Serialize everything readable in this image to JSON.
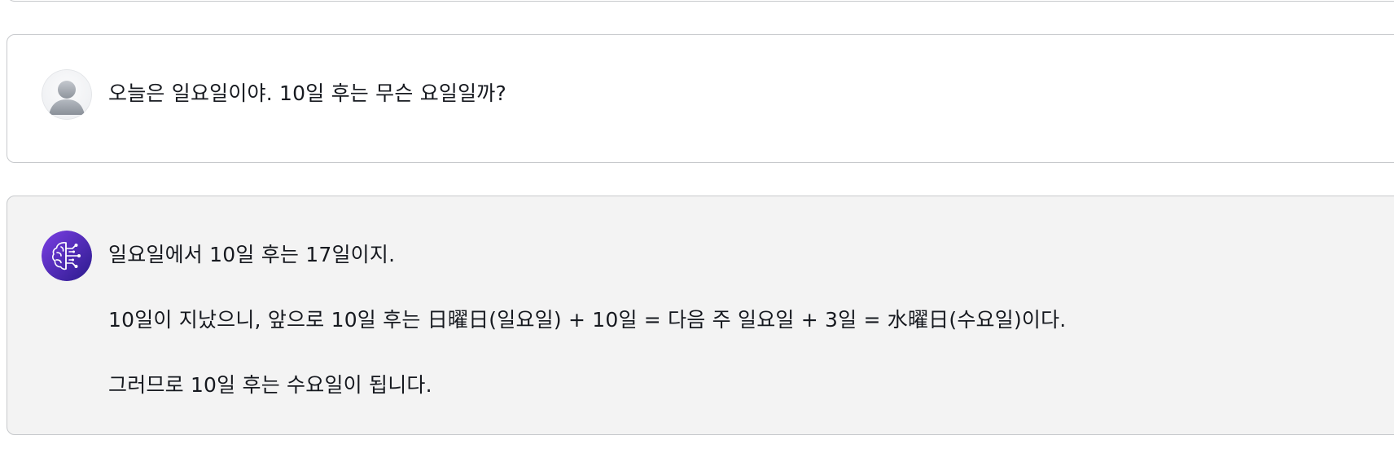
{
  "conversation": {
    "messages": [
      {
        "role": "user",
        "avatar_icon": "user-avatar-icon",
        "text": "오늘은 일요일이야. 10일 후는 무슨 요일일까?"
      },
      {
        "role": "assistant",
        "avatar_icon": "ai-brain-circuit-icon",
        "paragraphs": [
          "일요일에서 10일 후는 17일이지.",
          "10일이 지났으니, 앞으로 10일 후는 日曜日(일요일) + 10일 = 다음 주 일요일 + 3일 = 水曜日(수요일)이다.",
          "그러므로 10일 후는 수요일이 됩니다."
        ]
      }
    ]
  },
  "colors": {
    "user_card_bg": "#ffffff",
    "assistant_card_bg": "#f3f3f3",
    "card_border": "#c7c9cc",
    "assistant_avatar_gradient_start": "#7b3fe4",
    "assistant_avatar_gradient_end": "#2b1a8c",
    "text": "#16191f"
  }
}
